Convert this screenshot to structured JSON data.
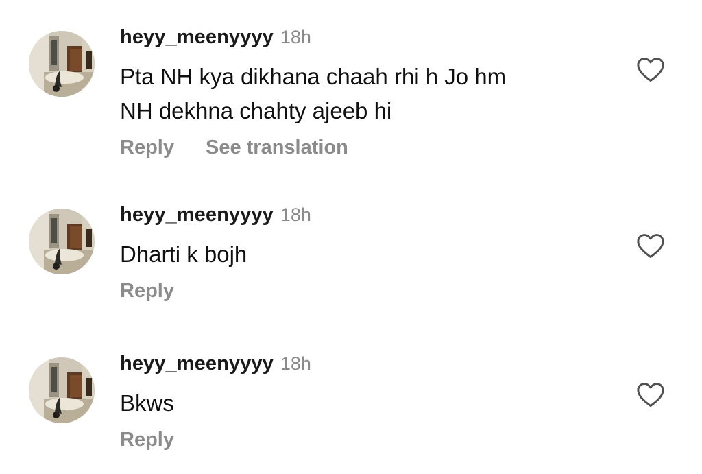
{
  "comments": [
    {
      "username": "heyy_meenyyyy",
      "time": "18h",
      "text_lines": [
        "Pta NH kya dikhana chaah rhi h Jo hm",
        "NH dekhna chahty ajeeb hi"
      ],
      "reply_label": "Reply",
      "translate_label": "See translation",
      "like_icon": "heart-outline-icon"
    },
    {
      "username": "heyy_meenyyyy",
      "time": "18h",
      "text_lines": [
        "Dharti k bojh"
      ],
      "reply_label": "Reply",
      "like_icon": "heart-outline-icon"
    },
    {
      "username": "heyy_meenyyyy",
      "time": "18h",
      "text_lines": [
        "Bkws"
      ],
      "reply_label": "Reply",
      "like_icon": "heart-outline-icon"
    }
  ],
  "colors": {
    "background": "#ffffff",
    "username": "#1a1a1a",
    "timestamp": "#8a8a8a",
    "action_text": "#8b8b8b",
    "heart_stroke": "#505050"
  }
}
